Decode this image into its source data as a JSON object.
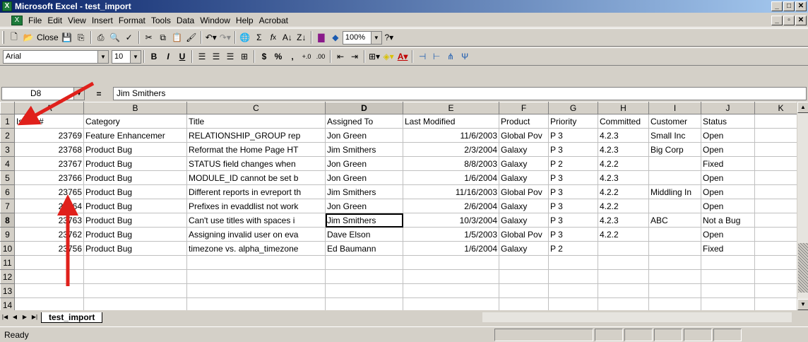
{
  "window": {
    "title": "Microsoft Excel - test_import"
  },
  "menu": [
    "File",
    "Edit",
    "View",
    "Insert",
    "Format",
    "Tools",
    "Data",
    "Window",
    "Help",
    "Acrobat"
  ],
  "toolbar1": {
    "close_label": "Close",
    "zoom": "100%"
  },
  "toolbar2": {
    "font": "Arial",
    "size": "10",
    "bold": "B",
    "italic": "I",
    "underline": "U",
    "currency": "$",
    "percent": "%",
    "comma": ","
  },
  "formula": {
    "cell_ref": "D8",
    "equals": "=",
    "value": "Jim Smithers"
  },
  "columns": [
    "A",
    "B",
    "C",
    "D",
    "E",
    "F",
    "G",
    "H",
    "I",
    "J",
    "K"
  ],
  "rows": [
    {
      "n": "1",
      "cells": [
        "Issue #",
        "Category",
        "Title",
        "Assigned To",
        "Last Modified",
        "Product",
        "Priority",
        "Committed",
        "Customer",
        "Status",
        ""
      ]
    },
    {
      "n": "2",
      "cells": [
        "23769",
        "Feature Enhancemer",
        "RELATIONSHIP_GROUP rep",
        "Jon Green",
        "11/6/2003",
        "Global Pov",
        "P 3",
        "4.2.3",
        "Small Inc",
        "Open",
        ""
      ]
    },
    {
      "n": "3",
      "cells": [
        "23768",
        "Product Bug",
        "Reformat the Home Page HT",
        "Jim Smithers",
        "2/3/2004",
        "Galaxy",
        "P 3",
        "4.2.3",
        "Big Corp",
        "Open",
        ""
      ]
    },
    {
      "n": "4",
      "cells": [
        "23767",
        "Product Bug",
        "STATUS field changes when",
        "Jon Green",
        "8/8/2003",
        "Galaxy",
        "P 2",
        "4.2.2",
        "",
        "Fixed",
        ""
      ]
    },
    {
      "n": "5",
      "cells": [
        "23766",
        "Product Bug",
        "MODULE_ID cannot be set b",
        "Jon Green",
        "1/6/2004",
        "Galaxy",
        "P 3",
        "4.2.3",
        "",
        "Open",
        ""
      ]
    },
    {
      "n": "6",
      "cells": [
        "23765",
        "Product Bug",
        "Different reports in evreport th",
        "Jim Smithers",
        "11/16/2003",
        "Global Pov",
        "P 3",
        "4.2.2",
        "Middling In",
        "Open",
        ""
      ]
    },
    {
      "n": "7",
      "cells": [
        "23764",
        "Product Bug",
        "Prefixes in evaddlist not work",
        "Jon Green",
        "2/6/2004",
        "Galaxy",
        "P 3",
        "4.2.2",
        "",
        "Open",
        ""
      ]
    },
    {
      "n": "8",
      "cells": [
        "23763",
        "Product Bug",
        "Can't use titles with spaces i",
        "Jim Smithers",
        "10/3/2004",
        "Galaxy",
        "P 3",
        "4.2.3",
        "ABC",
        "Not a Bug",
        ""
      ]
    },
    {
      "n": "9",
      "cells": [
        "23762",
        "Product Bug",
        "Assigning invalid user on eva",
        "Dave Elson",
        "1/5/2003",
        "Global Pov",
        "P 3",
        "4.2.2",
        "",
        "Open",
        ""
      ]
    },
    {
      "n": "10",
      "cells": [
        "23756",
        "Product Bug",
        "timezone vs. alpha_timezone",
        "Ed Baumann",
        "1/6/2004",
        "Galaxy",
        "P 2",
        "",
        "",
        "Fixed",
        ""
      ]
    },
    {
      "n": "11",
      "cells": [
        "",
        "",
        "",
        "",
        "",
        "",
        "",
        "",
        "",
        "",
        ""
      ]
    },
    {
      "n": "12",
      "cells": [
        "",
        "",
        "",
        "",
        "",
        "",
        "",
        "",
        "",
        "",
        ""
      ]
    },
    {
      "n": "13",
      "cells": [
        "",
        "",
        "",
        "",
        "",
        "",
        "",
        "",
        "",
        "",
        ""
      ]
    },
    {
      "n": "14",
      "cells": [
        "",
        "",
        "",
        "",
        "",
        "",
        "",
        "",
        "",
        "",
        ""
      ]
    }
  ],
  "sheet_tab": "test_import",
  "status": "Ready",
  "colors": {
    "title_start": "#0a246a",
    "title_end": "#a6caf0",
    "arrow": "#e0201b"
  }
}
